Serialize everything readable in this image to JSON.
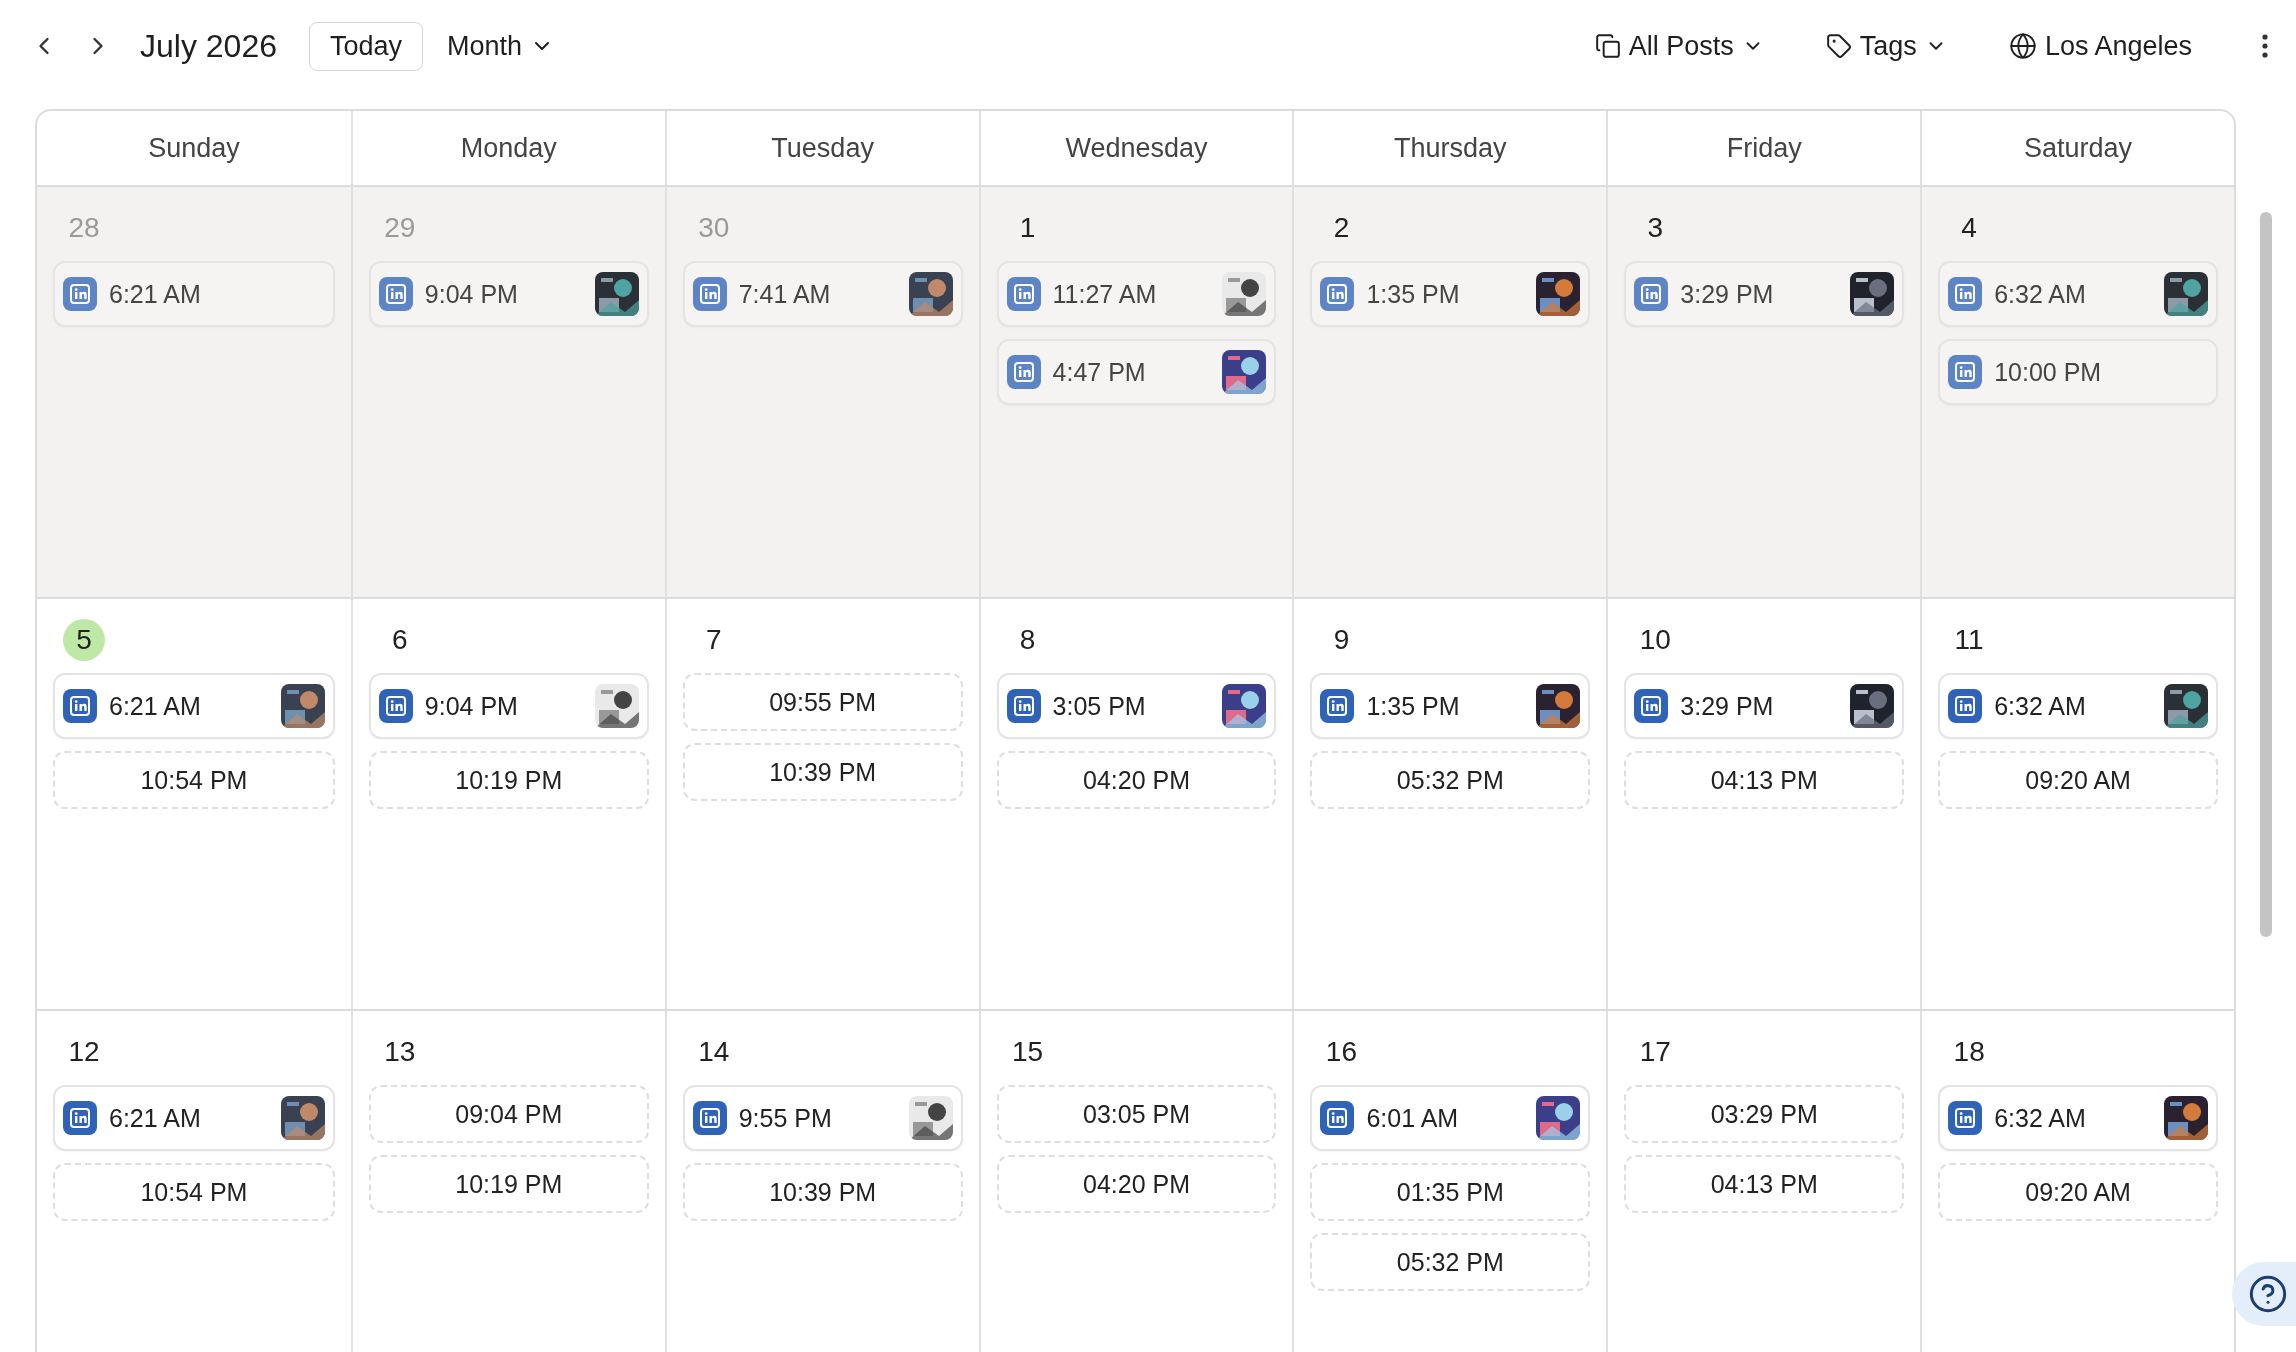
{
  "toolbar": {
    "title": "July 2026",
    "today_button": "Today",
    "view": "Month",
    "filters": [
      {
        "kind": "posts",
        "label": "All Posts"
      },
      {
        "kind": "tags",
        "label": "Tags"
      }
    ],
    "timezone": "Los Angeles"
  },
  "weekdays": [
    "Sunday",
    "Monday",
    "Tuesday",
    "Wednesday",
    "Thursday",
    "Friday",
    "Saturday"
  ],
  "weeks": [
    {
      "past": true,
      "days": [
        {
          "date": "28",
          "outside_month": true,
          "today": false,
          "items": [
            {
              "kind": "post",
              "time": "6:21 AM",
              "image": false
            }
          ]
        },
        {
          "date": "29",
          "outside_month": true,
          "today": false,
          "items": [
            {
              "kind": "post",
              "time": "9:04 PM",
              "image": true
            }
          ]
        },
        {
          "date": "30",
          "outside_month": true,
          "today": false,
          "items": [
            {
              "kind": "post",
              "time": "7:41 AM",
              "image": true
            }
          ]
        },
        {
          "date": "1",
          "outside_month": false,
          "today": false,
          "items": [
            {
              "kind": "post",
              "time": "11:27 AM",
              "image": true
            },
            {
              "kind": "post",
              "time": "4:47 PM",
              "image": true
            }
          ]
        },
        {
          "date": "2",
          "outside_month": false,
          "today": false,
          "items": [
            {
              "kind": "post",
              "time": "1:35 PM",
              "image": true
            }
          ]
        },
        {
          "date": "3",
          "outside_month": false,
          "today": false,
          "items": [
            {
              "kind": "post",
              "time": "3:29 PM",
              "image": true
            }
          ]
        },
        {
          "date": "4",
          "outside_month": false,
          "today": false,
          "items": [
            {
              "kind": "post",
              "time": "6:32 AM",
              "image": true
            },
            {
              "kind": "post",
              "time": "10:00 PM",
              "image": false
            }
          ]
        }
      ]
    },
    {
      "past": false,
      "days": [
        {
          "date": "5",
          "outside_month": false,
          "today": true,
          "items": [
            {
              "kind": "post",
              "time": "6:21 AM",
              "image": true
            },
            {
              "kind": "slot",
              "time": "10:54 PM"
            }
          ]
        },
        {
          "date": "6",
          "outside_month": false,
          "today": false,
          "items": [
            {
              "kind": "post",
              "time": "9:04 PM",
              "image": true
            },
            {
              "kind": "slot",
              "time": "10:19 PM"
            }
          ]
        },
        {
          "date": "7",
          "outside_month": false,
          "today": false,
          "items": [
            {
              "kind": "slot",
              "time": "09:55 PM"
            },
            {
              "kind": "slot",
              "time": "10:39 PM"
            }
          ]
        },
        {
          "date": "8",
          "outside_month": false,
          "today": false,
          "items": [
            {
              "kind": "post",
              "time": "3:05 PM",
              "image": true
            },
            {
              "kind": "slot",
              "time": "04:20 PM"
            }
          ]
        },
        {
          "date": "9",
          "outside_month": false,
          "today": false,
          "items": [
            {
              "kind": "post",
              "time": "1:35 PM",
              "image": true
            },
            {
              "kind": "slot",
              "time": "05:32 PM"
            }
          ]
        },
        {
          "date": "10",
          "outside_month": false,
          "today": false,
          "items": [
            {
              "kind": "post",
              "time": "3:29 PM",
              "image": true
            },
            {
              "kind": "slot",
              "time": "04:13 PM"
            }
          ]
        },
        {
          "date": "11",
          "outside_month": false,
          "today": false,
          "items": [
            {
              "kind": "post",
              "time": "6:32 AM",
              "image": true
            },
            {
              "kind": "slot",
              "time": "09:20 AM"
            }
          ]
        }
      ]
    },
    {
      "past": false,
      "days": [
        {
          "date": "12",
          "outside_month": false,
          "today": false,
          "items": [
            {
              "kind": "post",
              "time": "6:21 AM",
              "image": true
            },
            {
              "kind": "slot",
              "time": "10:54 PM"
            }
          ]
        },
        {
          "date": "13",
          "outside_month": false,
          "today": false,
          "items": [
            {
              "kind": "slot",
              "time": "09:04 PM"
            },
            {
              "kind": "slot",
              "time": "10:19 PM"
            }
          ]
        },
        {
          "date": "14",
          "outside_month": false,
          "today": false,
          "items": [
            {
              "kind": "post",
              "time": "9:55 PM",
              "image": true
            },
            {
              "kind": "slot",
              "time": "10:39 PM"
            }
          ]
        },
        {
          "date": "15",
          "outside_month": false,
          "today": false,
          "items": [
            {
              "kind": "slot",
              "time": "03:05 PM"
            },
            {
              "kind": "slot",
              "time": "04:20 PM"
            }
          ]
        },
        {
          "date": "16",
          "outside_month": false,
          "today": false,
          "items": [
            {
              "kind": "post",
              "time": "6:01 AM",
              "image": true
            },
            {
              "kind": "slot",
              "time": "01:35 PM"
            },
            {
              "kind": "slot",
              "time": "05:32 PM"
            }
          ]
        },
        {
          "date": "17",
          "outside_month": false,
          "today": false,
          "items": [
            {
              "kind": "slot",
              "time": "03:29 PM"
            },
            {
              "kind": "slot",
              "time": "04:13 PM"
            }
          ]
        },
        {
          "date": "18",
          "outside_month": false,
          "today": false,
          "items": [
            {
              "kind": "post",
              "time": "6:32 AM",
              "image": true
            },
            {
              "kind": "slot",
              "time": "09:20 AM"
            }
          ]
        }
      ]
    }
  ]
}
